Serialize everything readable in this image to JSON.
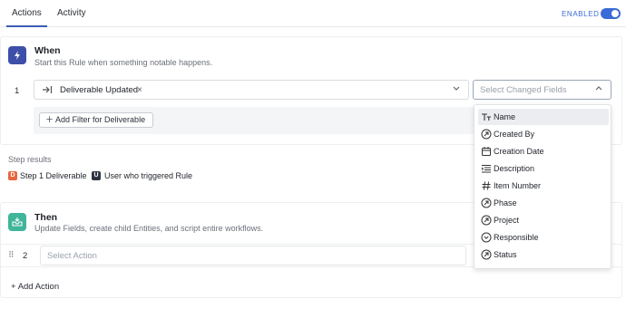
{
  "tabs": [
    {
      "label": "Actions",
      "active": true
    },
    {
      "label": "Activity",
      "active": false
    }
  ],
  "enabled": {
    "label": "ENABLED",
    "on": true
  },
  "when": {
    "title": "When",
    "subtitle": "Start this Rule when something notable happens.",
    "step_number": "1",
    "trigger": "Deliverable Updated",
    "changed_fields_placeholder": "Select Changed Fields",
    "add_filter_label": "Add Filter for Deliverable"
  },
  "step_results": {
    "label": "Step results",
    "items": [
      {
        "badge": "D",
        "text": "Step 1 Deliverable",
        "color": "#e8663d"
      },
      {
        "badge": "U",
        "text": "User who triggered Rule",
        "color": "#2e3440"
      }
    ]
  },
  "then": {
    "title": "Then",
    "subtitle": "Update Fields, create child Entities, and script entire workflows.",
    "step_number": "2",
    "action_placeholder": "Select Action",
    "add_action_label": "Add Action"
  },
  "dropdown": {
    "items": [
      {
        "label": "Name",
        "icon": "text-type-icon",
        "highlighted": true
      },
      {
        "label": "Created By",
        "icon": "user-circle-icon"
      },
      {
        "label": "Creation Date",
        "icon": "calendar-icon"
      },
      {
        "label": "Description",
        "icon": "paragraph-icon"
      },
      {
        "label": "Item Number",
        "icon": "hash-icon"
      },
      {
        "label": "Phase",
        "icon": "arrow-circle-icon"
      },
      {
        "label": "Project",
        "icon": "arrow-circle-icon"
      },
      {
        "label": "Responsible",
        "icon": "chevron-circle-icon"
      },
      {
        "label": "Status",
        "icon": "arrow-circle-icon"
      }
    ]
  },
  "colors": {
    "accent": "#3b6bd6",
    "when_icon_bg": "#3d4fa8",
    "then_icon_bg": "#3fb59a"
  }
}
